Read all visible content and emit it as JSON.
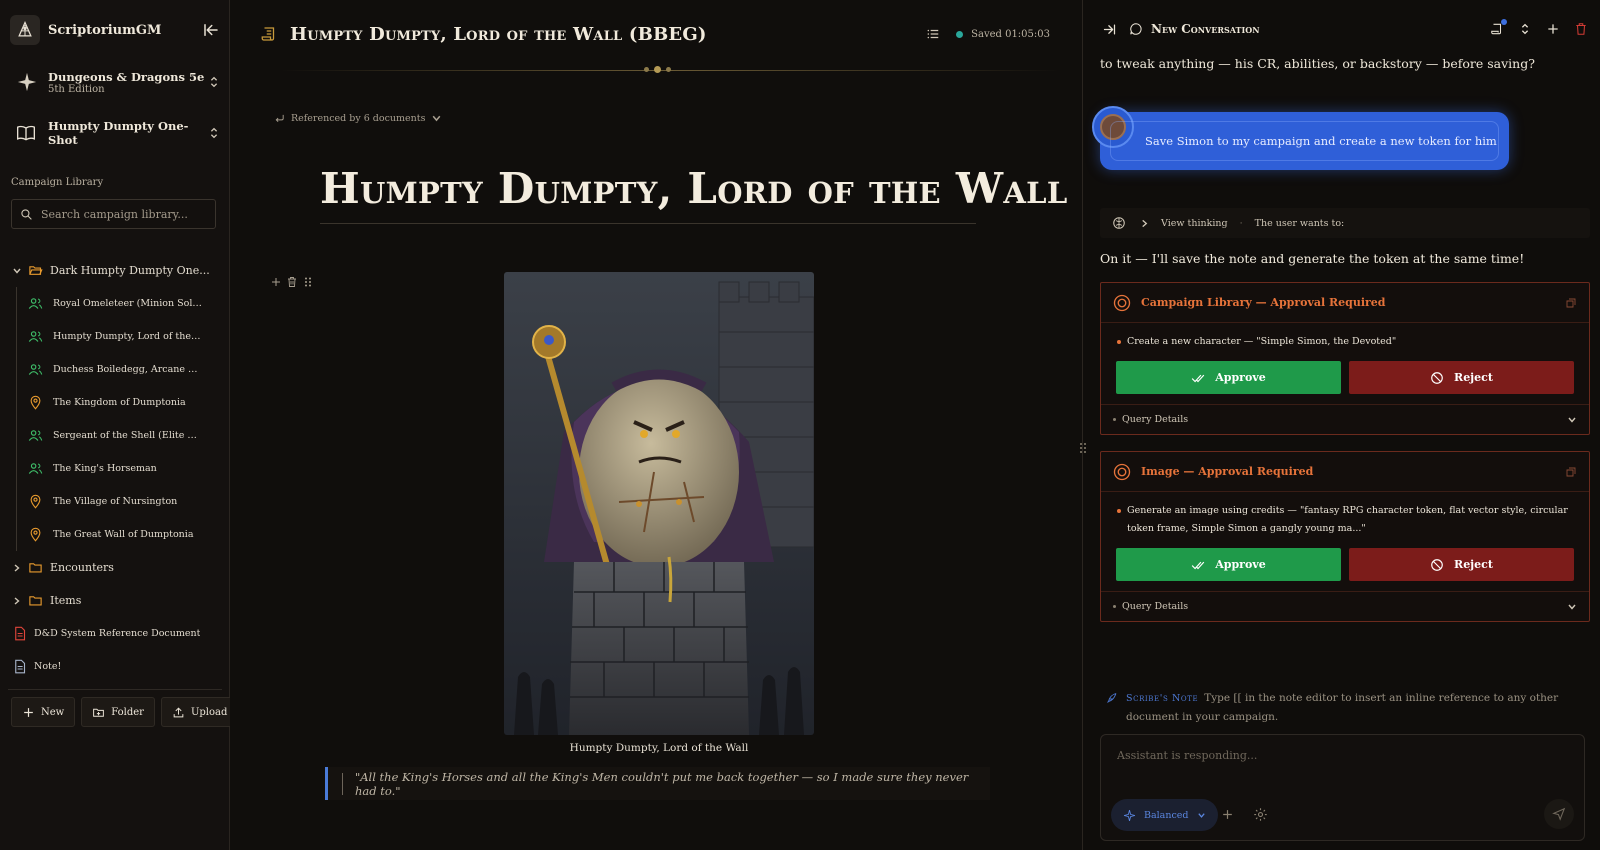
{
  "app": {
    "name": "ScriptoriumGM"
  },
  "system": {
    "name": "Dungeons & Dragons 5e",
    "edition": "5th Edition"
  },
  "campaign": {
    "name": "Humpty Dumpty One-Shot"
  },
  "library": {
    "title": "Campaign Library",
    "search_placeholder": "Search campaign library...",
    "tree": {
      "root_folder": "Dark Humpty Dumpty One...",
      "children": [
        {
          "label": "Royal Omeleteer (Minion Soldi...",
          "kind": "character"
        },
        {
          "label": "Humpty Dumpty, Lord of the ...",
          "kind": "character"
        },
        {
          "label": "Duchess Boiledegg, Arcane Adv...",
          "kind": "character"
        },
        {
          "label": "The Kingdom of Dumptonia",
          "kind": "location"
        },
        {
          "label": "Sergeant of the Shell (Elite Sold...",
          "kind": "character"
        },
        {
          "label": "The King's Horseman",
          "kind": "character"
        },
        {
          "label": "The Village of Nursington",
          "kind": "location"
        },
        {
          "label": "The Great Wall of Dumptonia",
          "kind": "location"
        }
      ],
      "folders": [
        "Encounters",
        "Items"
      ],
      "docs": [
        {
          "label": "D&D System Reference Document",
          "kind": "pdf"
        },
        {
          "label": "Note!",
          "kind": "note"
        }
      ]
    },
    "actions": {
      "new": "New",
      "folder": "Folder",
      "upload": "Upload"
    }
  },
  "document": {
    "header_title": "Humpty Dumpty, Lord of the Wall (BBEG)",
    "saved": "Saved 01:05:03",
    "referenced_by": "Referenced by 6 documents",
    "heading": "Humpty Dumpty, Lord of the Wall",
    "caption": "Humpty Dumpty, Lord of the Wall",
    "quote": "\"All the King's Horses and all the King's Men couldn't put me back together — so I made sure they never had to.\""
  },
  "chat": {
    "title": "New Conversation",
    "prev_message_tail": "to tweak anything — his CR, abilities, or backstory — before saving?",
    "user_message": "Save Simon to my campaign and create a new token for him",
    "thinking": {
      "label": "View thinking",
      "preview": "The user wants to:"
    },
    "answer": "On it — I'll save the note and generate the token at the same time!",
    "approvals": [
      {
        "title": "Campaign Library — Approval Required",
        "detail": "Create a new character — \"Simple Simon, the Devoted\"",
        "approve": "Approve",
        "reject": "Reject",
        "query": "Query Details"
      },
      {
        "title": "Image — Approval Required",
        "detail": "Generate an image using credits — \"fantasy RPG character token, flat vector style, circular token frame, Simple Simon a gangly young ma...\"",
        "approve": "Approve",
        "reject": "Reject",
        "query": "Query Details"
      }
    ],
    "scribe_note": {
      "label": "Scribe's Note",
      "text": "Type [[ in the note editor to insert an inline reference to any other document in your campaign."
    },
    "composer": {
      "placeholder": "Assistant is responding...",
      "mode": "Balanced"
    }
  },
  "colors": {
    "background": "#0f0d0b",
    "accent_blue": "#2f5fd8",
    "approve_green": "#1f9a4a",
    "reject_red": "#7c1c1a",
    "warning_orange": "#e6733a",
    "character_icon": "#3fbf6a",
    "location_icon": "#e79a2e",
    "folder_icon": "#e79a2e",
    "saved_dot": "#2aa79b"
  },
  "icons": {
    "brand": "quill-scroll-icon",
    "system": "compass-rose-icon",
    "campaign": "open-book-icon",
    "character": "users-icon",
    "location": "map-pin-icon",
    "folder": "folder-icon",
    "pdf": "pdf-file-icon",
    "note": "note-file-icon"
  }
}
